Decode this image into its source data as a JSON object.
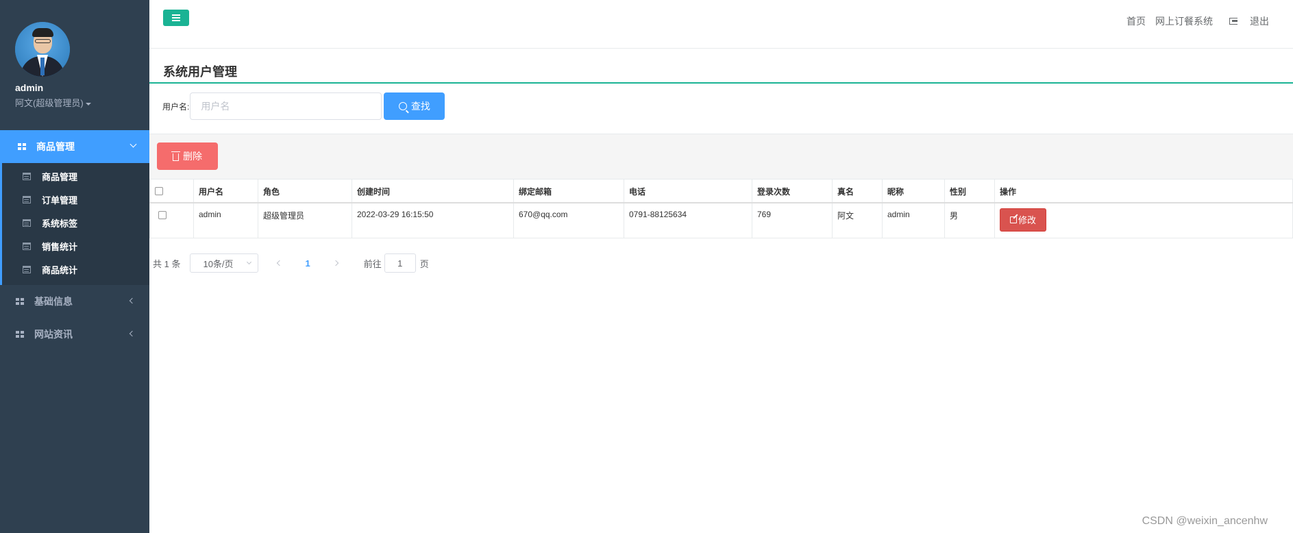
{
  "profile": {
    "username": "admin",
    "role": "阿文(超级管理员)"
  },
  "sidebar": {
    "active_menu": "商品管理",
    "submenu": [
      "商品管理",
      "订单管理",
      "系统标签",
      "销售统计",
      "商品统计"
    ],
    "menus": [
      "基础信息",
      "网站资讯"
    ]
  },
  "topbar": {
    "home": "首页",
    "system": "网上订餐系统",
    "logout": "退出"
  },
  "page": {
    "title": "系统用户管理"
  },
  "search": {
    "label": "用户名:",
    "placeholder": "用户名",
    "button": "查找"
  },
  "toolbar": {
    "delete_label": "删除"
  },
  "table": {
    "headers": [
      "用户名",
      "角色",
      "创建时间",
      "绑定邮箱",
      "电话",
      "登录次数",
      "真名",
      "昵称",
      "性别",
      "操作"
    ],
    "rows": [
      {
        "username": "admin",
        "role": "超级管理员",
        "created": "2022-03-29 16:15:50",
        "email": "670@qq.com",
        "phone": "0791-88125634",
        "logins": "769",
        "realname": "阿文",
        "nickname": "admin",
        "gender": "男",
        "action": "修改"
      }
    ]
  },
  "pagination": {
    "total": "共 1 条",
    "page_size": "10条/页",
    "current": "1",
    "goto_label": "前往",
    "goto_value": "1",
    "page_suffix": "页"
  },
  "watermark": "CSDN @weixin_ancenhw",
  "colors": {
    "sidebar": "#2f4050",
    "active": "#409eff",
    "accent": "#1ab394",
    "danger": "#f56c6c"
  }
}
